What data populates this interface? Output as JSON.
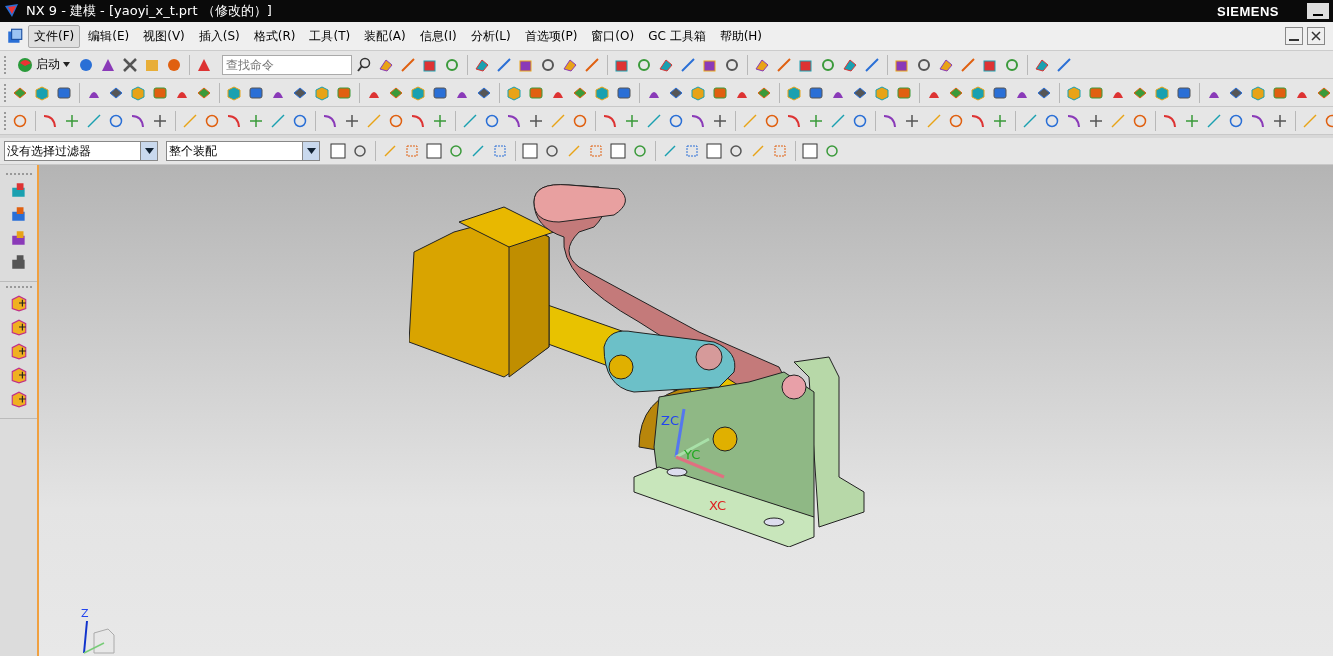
{
  "window": {
    "title": "NX 9 - 建模 - [yaoyi_x_t.prt （修改的）]",
    "brand": "SIEMENS"
  },
  "menu": [
    {
      "label": "文件(F)",
      "selected": true
    },
    {
      "label": "编辑(E)",
      "selected": false
    },
    {
      "label": "视图(V)",
      "selected": false
    },
    {
      "label": "插入(S)",
      "selected": false
    },
    {
      "label": "格式(R)",
      "selected": false
    },
    {
      "label": "工具(T)",
      "selected": false
    },
    {
      "label": "装配(A)",
      "selected": false
    },
    {
      "label": "信息(I)",
      "selected": false
    },
    {
      "label": "分析(L)",
      "selected": false
    },
    {
      "label": "首选项(P)",
      "selected": false
    },
    {
      "label": "窗口(O)",
      "selected": false
    },
    {
      "label": "GC 工具箱",
      "selected": false
    },
    {
      "label": "帮助(H)",
      "selected": false
    }
  ],
  "toolbar": {
    "start_button": "启动",
    "search": {
      "placeholder": "查找命令"
    }
  },
  "selection_bar": {
    "filter": "没有选择过滤器",
    "scope": "整个装配"
  },
  "viewport": {
    "wcs_labels": [
      "ZC",
      "YC",
      "XC"
    ],
    "triad_label": "Z"
  }
}
